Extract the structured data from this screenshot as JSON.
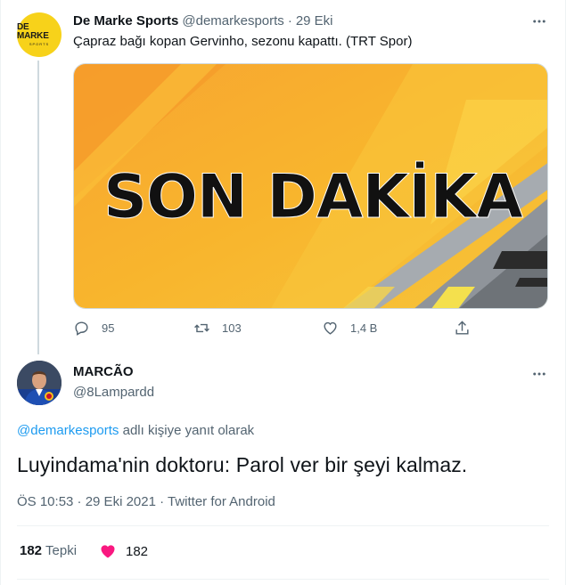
{
  "tweet1": {
    "avatar_logo_main": "DE MARKE",
    "avatar_logo_sub": "SPORTS",
    "display_name": "De Marke Sports",
    "handle": "@demarkesports",
    "separator": "·",
    "date": "29 Eki",
    "text": "Çapraz bağı kopan Gervinho, sezonu kapattı. (TRT Spor)",
    "media_text": "SON DAKİKA",
    "actions": {
      "reply_count": "95",
      "retweet_count": "103",
      "like_count": "1,4 B"
    }
  },
  "tweet2": {
    "display_name": "MARCÃO",
    "handle": "@8Lampardd",
    "reply_mention": "@demarkesports",
    "reply_suffix": " adlı kişiye yanıt olarak",
    "text": "Luyindama'nin doktoru: Parol ver bir şeyi kalmaz.",
    "meta": "ÖS 10:53 · 29 Eki 2021 · Twitter for Android",
    "reaction_count": "182",
    "reaction_label": "Tepki",
    "like_count": "182"
  },
  "colors": {
    "accent": "#1d9bf0",
    "like": "#f91880",
    "secondary_text": "#536471",
    "media_yellow": "#f7b32b"
  },
  "icons": [
    "more-icon",
    "reply-icon",
    "retweet-icon",
    "like-icon",
    "share-icon",
    "heart-icon"
  ]
}
